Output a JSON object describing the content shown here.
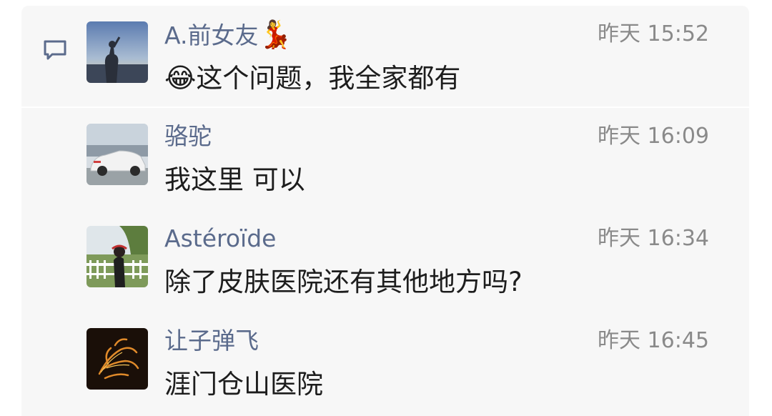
{
  "comments": [
    {
      "name": "A.前女友",
      "name_emoji": "💃",
      "time": "昨天 15:52",
      "text_emoji": "😂",
      "text": "这个问题，我全家都有"
    },
    {
      "name": "骆驼",
      "time": "昨天 16:09",
      "text": "我这里 可以"
    },
    {
      "name": "Astéroïde",
      "time": "昨天 16:34",
      "text": "除了皮肤医院还有其他地方吗?"
    },
    {
      "name": "让子弹飞",
      "time": "昨天 16:45",
      "text": "涯门仓山医院"
    }
  ],
  "icons": {
    "comment": "comment-bubble-icon"
  },
  "colors": {
    "name": "#5b6b8c",
    "time": "#8a8a8a",
    "text": "#1d1d1d",
    "panel": "#f7f7f7"
  }
}
